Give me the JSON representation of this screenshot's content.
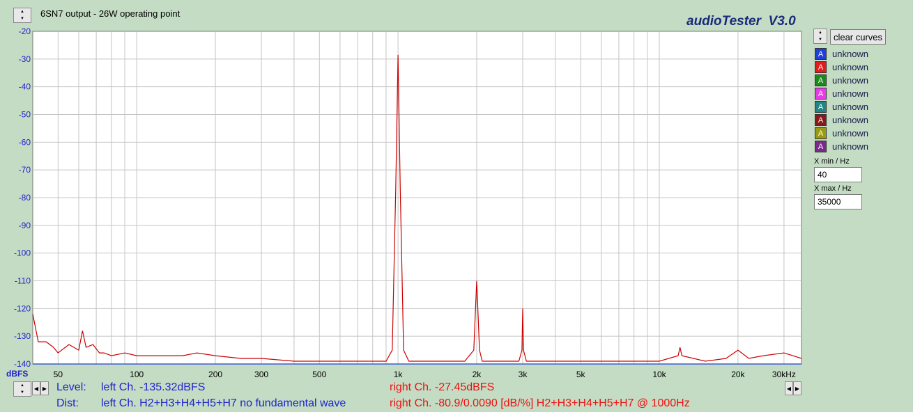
{
  "header": {
    "title": "6SN7 output - 26W operating point",
    "brand": "audioTester  V3.0"
  },
  "controls": {
    "clear_label": "clear curves",
    "xmin_label": "X min / Hz",
    "xmin_value": "40",
    "xmax_label": "X max / Hz",
    "xmax_value": "35000"
  },
  "legend": [
    {
      "glyph": "A",
      "label": "unknown",
      "color": "#1f3fd8"
    },
    {
      "glyph": "A",
      "label": "unknown",
      "color": "#e21c1c"
    },
    {
      "glyph": "A",
      "label": "unknown",
      "color": "#1a8a1a"
    },
    {
      "glyph": "A",
      "label": "unknown",
      "color": "#e63be6"
    },
    {
      "glyph": "A",
      "label": "unknown",
      "color": "#218585"
    },
    {
      "glyph": "A",
      "label": "unknown",
      "color": "#8a1a1a"
    },
    {
      "glyph": "A",
      "label": "unknown",
      "color": "#9a9a12"
    },
    {
      "glyph": "A",
      "label": "unknown",
      "color": "#7a2a8a"
    }
  ],
  "status": {
    "level_label": "Level:",
    "dist_label": "Dist:",
    "level_left": "left Ch. -135.32dBFS",
    "level_right": "right Ch. -27.45dBFS",
    "dist_left": "left Ch. H2+H3+H4+H5+H7 no fundamental wave",
    "dist_right": "right Ch. -80.9/0.0090 [dB/%] H2+H3+H4+H5+H7 @ 1000Hz"
  },
  "chart_data": {
    "type": "line",
    "title": "6SN7 output - 26W operating point",
    "ylabel": "dBFS",
    "xscale": "log",
    "xlim": [
      40,
      35000
    ],
    "ylim": [
      -140,
      -20
    ],
    "grid": true,
    "ytick_labels": [
      "-20",
      "-30",
      "-40",
      "-50",
      "-60",
      "-70",
      "-80",
      "-90",
      "-100",
      "-110",
      "-120",
      "-130",
      "-140"
    ],
    "ytick_values": [
      -20,
      -30,
      -40,
      -50,
      -60,
      -70,
      -80,
      -90,
      -100,
      -110,
      -120,
      -130,
      -140
    ],
    "xtick_labels": [
      "50",
      "100",
      "200",
      "300",
      "500",
      "1k",
      "2k",
      "3k",
      "5k",
      "10k",
      "20k",
      "30kHz"
    ],
    "xtick_values": [
      50,
      100,
      200,
      300,
      500,
      1000,
      2000,
      3000,
      5000,
      10000,
      20000,
      30000
    ],
    "series": [
      {
        "color": "#cc0000",
        "x": [
          40,
          42,
          45,
          48,
          50,
          55,
          60,
          62,
          64,
          68,
          72,
          75,
          80,
          90,
          100,
          120,
          150,
          170,
          200,
          250,
          300,
          400,
          500,
          600,
          700,
          800,
          900,
          950,
          980,
          1000,
          1020,
          1050,
          1100,
          1200,
          1500,
          1800,
          1950,
          1980,
          2000,
          2020,
          2050,
          2100,
          2500,
          2900,
          2980,
          3000,
          3020,
          3100,
          4000,
          5000,
          7000,
          10000,
          11800,
          12000,
          12200,
          15000,
          18000,
          20000,
          22000,
          25000,
          30000,
          35000
        ],
        "y": [
          -122,
          -132,
          -132,
          -134,
          -136,
          -133,
          -135,
          -128,
          -134,
          -133,
          -136,
          -136,
          -137,
          -136,
          -137,
          -137,
          -137,
          -136,
          -137,
          -138,
          -138,
          -139,
          -139,
          -139,
          -139,
          -139,
          -139,
          -135,
          -77,
          -28.5,
          -77,
          -135,
          -139,
          -139,
          -139,
          -139,
          -135,
          -120,
          -110,
          -120,
          -135,
          -139,
          -139,
          -139,
          -135,
          -120,
          -135,
          -139,
          -139,
          -139,
          -139,
          -139,
          -137,
          -134,
          -137,
          -139,
          -138,
          -135,
          -138,
          -137,
          -136,
          -138
        ]
      },
      {
        "color": "#1f3fd8",
        "x": [
          40,
          35000
        ],
        "y": [
          -140,
          -140
        ]
      }
    ]
  }
}
